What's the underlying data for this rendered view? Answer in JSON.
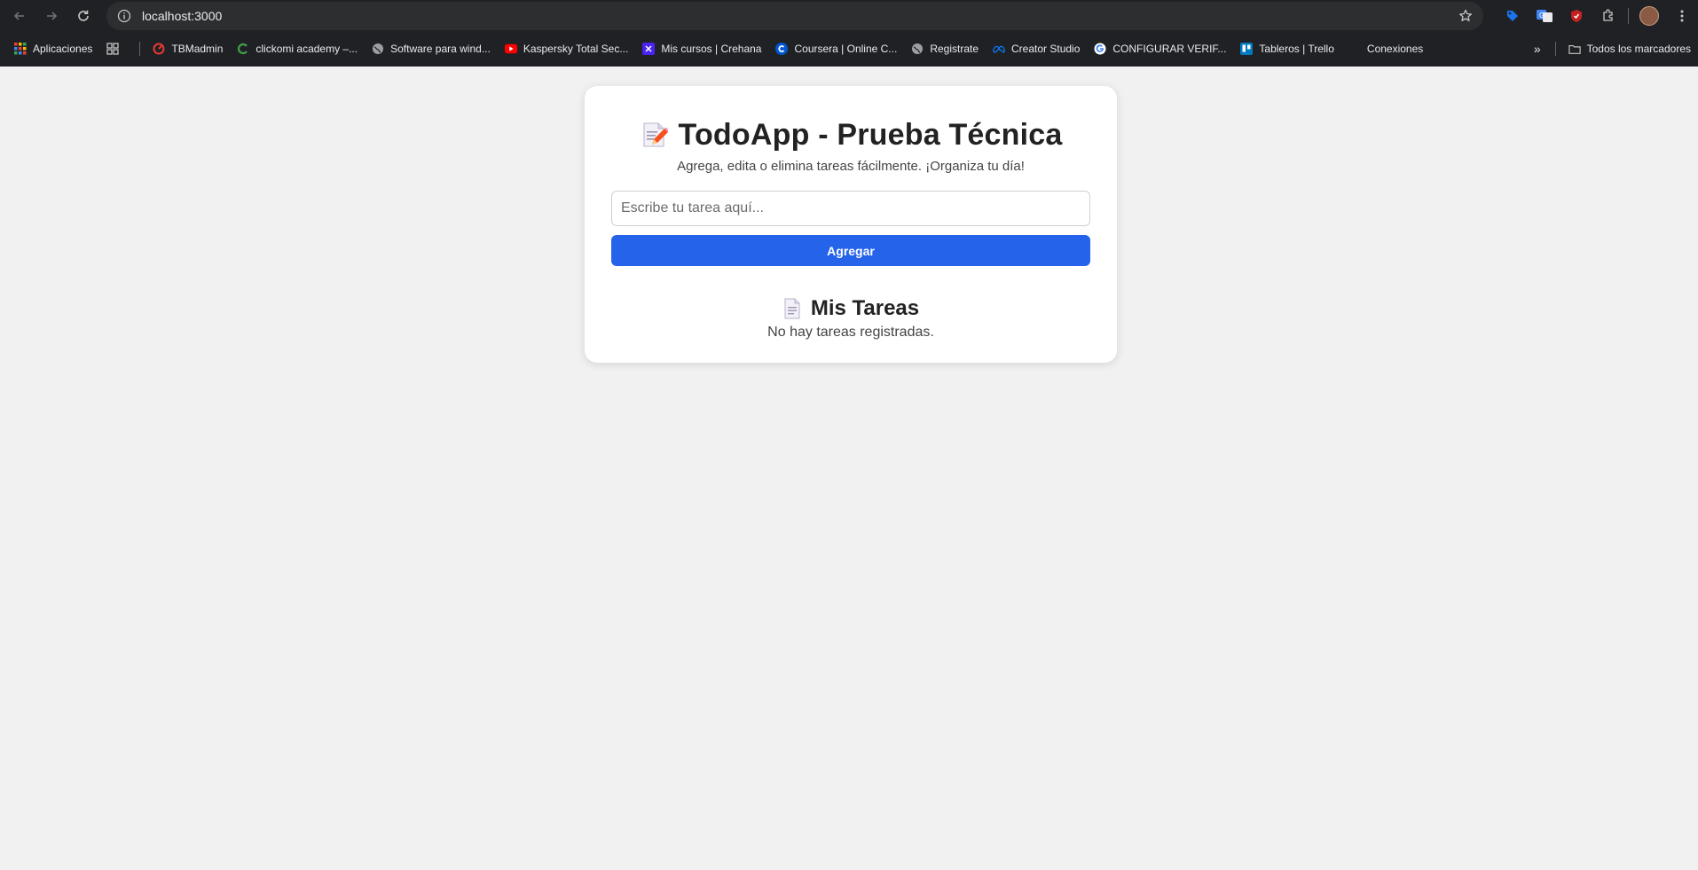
{
  "browser": {
    "url": "localhost:3000",
    "bookmarks": [
      {
        "label": "Aplicaciones",
        "icon": "apps-grid-icon"
      },
      {
        "label": "TBMadmin",
        "icon": "tbm-icon"
      },
      {
        "label": "clickomi academy –...",
        "icon": "clickomi-icon"
      },
      {
        "label": "Software para wind...",
        "icon": "globe-icon"
      },
      {
        "label": "Kaspersky Total Sec...",
        "icon": "youtube-icon"
      },
      {
        "label": "Mis cursos | Crehana",
        "icon": "crehana-icon"
      },
      {
        "label": "Coursera | Online C...",
        "icon": "coursera-icon"
      },
      {
        "label": "Registrate",
        "icon": "globe-icon"
      },
      {
        "label": "Creator Studio",
        "icon": "meta-icon"
      },
      {
        "label": "CONFIGURAR VERIF...",
        "icon": "google-icon"
      },
      {
        "label": "Tableros | Trello",
        "icon": "trello-icon"
      },
      {
        "label": "Conexiones",
        "icon": "blank-icon"
      }
    ],
    "all_bookmarks_label": "Todos los marcadores"
  },
  "app": {
    "title": "TodoApp - Prueba Técnica",
    "subtitle": "Agrega, edita o elimina tareas fácilmente. ¡Organiza tu día!",
    "input_placeholder": "Escribe tu tarea aquí...",
    "add_button_label": "Agregar",
    "tasks_heading": "Mis Tareas",
    "empty_message": "No hay tareas registradas."
  },
  "colors": {
    "accent": "#2563eb",
    "page_background": "#f1f1f1",
    "chrome_background": "#202124"
  }
}
